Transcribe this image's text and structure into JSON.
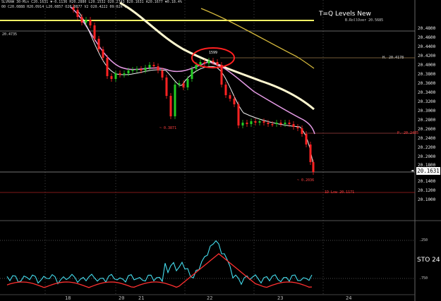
{
  "header": {
    "line1": "SLVRAW 30-Min  C20.1631  ▼-0.1136  H20.2880  L20.1532  O20.2743  B20.1631  A20.1677  ▼0.18.4%",
    "line2": "00  C20.0888  H20.0914  L20.0857  O20.0877  V2  O20.4222  09:02h 1"
  },
  "indicator_title": "T=Q Levels New",
  "roll_over_label": "B.RollOver 20.5685",
  "left_level_label": "20.4735",
  "annotations": {
    "h": "H. 20.4178",
    "p": "P. 20.2485",
    "low_left": "~ 0.3871",
    "low_right": "~ 0.2036",
    "hod": "1599",
    "ld_low": "1D Low 20.1171"
  },
  "price_axis": [
    "20.4800",
    "20.4600",
    "20.4400",
    "20.4200",
    "20.4000",
    "20.3800",
    "20.3600",
    "20.3400",
    "20.3200",
    "20.3000",
    "20.2800",
    "20.2600",
    "20.2400",
    "20.2200",
    "20.2000",
    "20.1800",
    "20.1600",
    "20.1400",
    "20.1200",
    "20.1000"
  ],
  "current_price": "20.1631",
  "sto_label": "STO 24",
  "sto_levels": [
    ".250",
    ".750"
  ],
  "x_axis": [
    "18",
    "20",
    "21",
    "22",
    "23",
    "24"
  ],
  "colors": {
    "yellow_line": "#ffff66",
    "ma_cream": "#fff8d0",
    "ma_pink": "#e49ae4",
    "ma_white": "#f0f0f0",
    "ma_gold": "#d4b83c",
    "candle_green": "#22cc22",
    "candle_red": "#ff2222",
    "stoch_cyan": "#44ddee",
    "stoch_red": "#ff3030",
    "highlight_circle": "#ff2020"
  }
}
